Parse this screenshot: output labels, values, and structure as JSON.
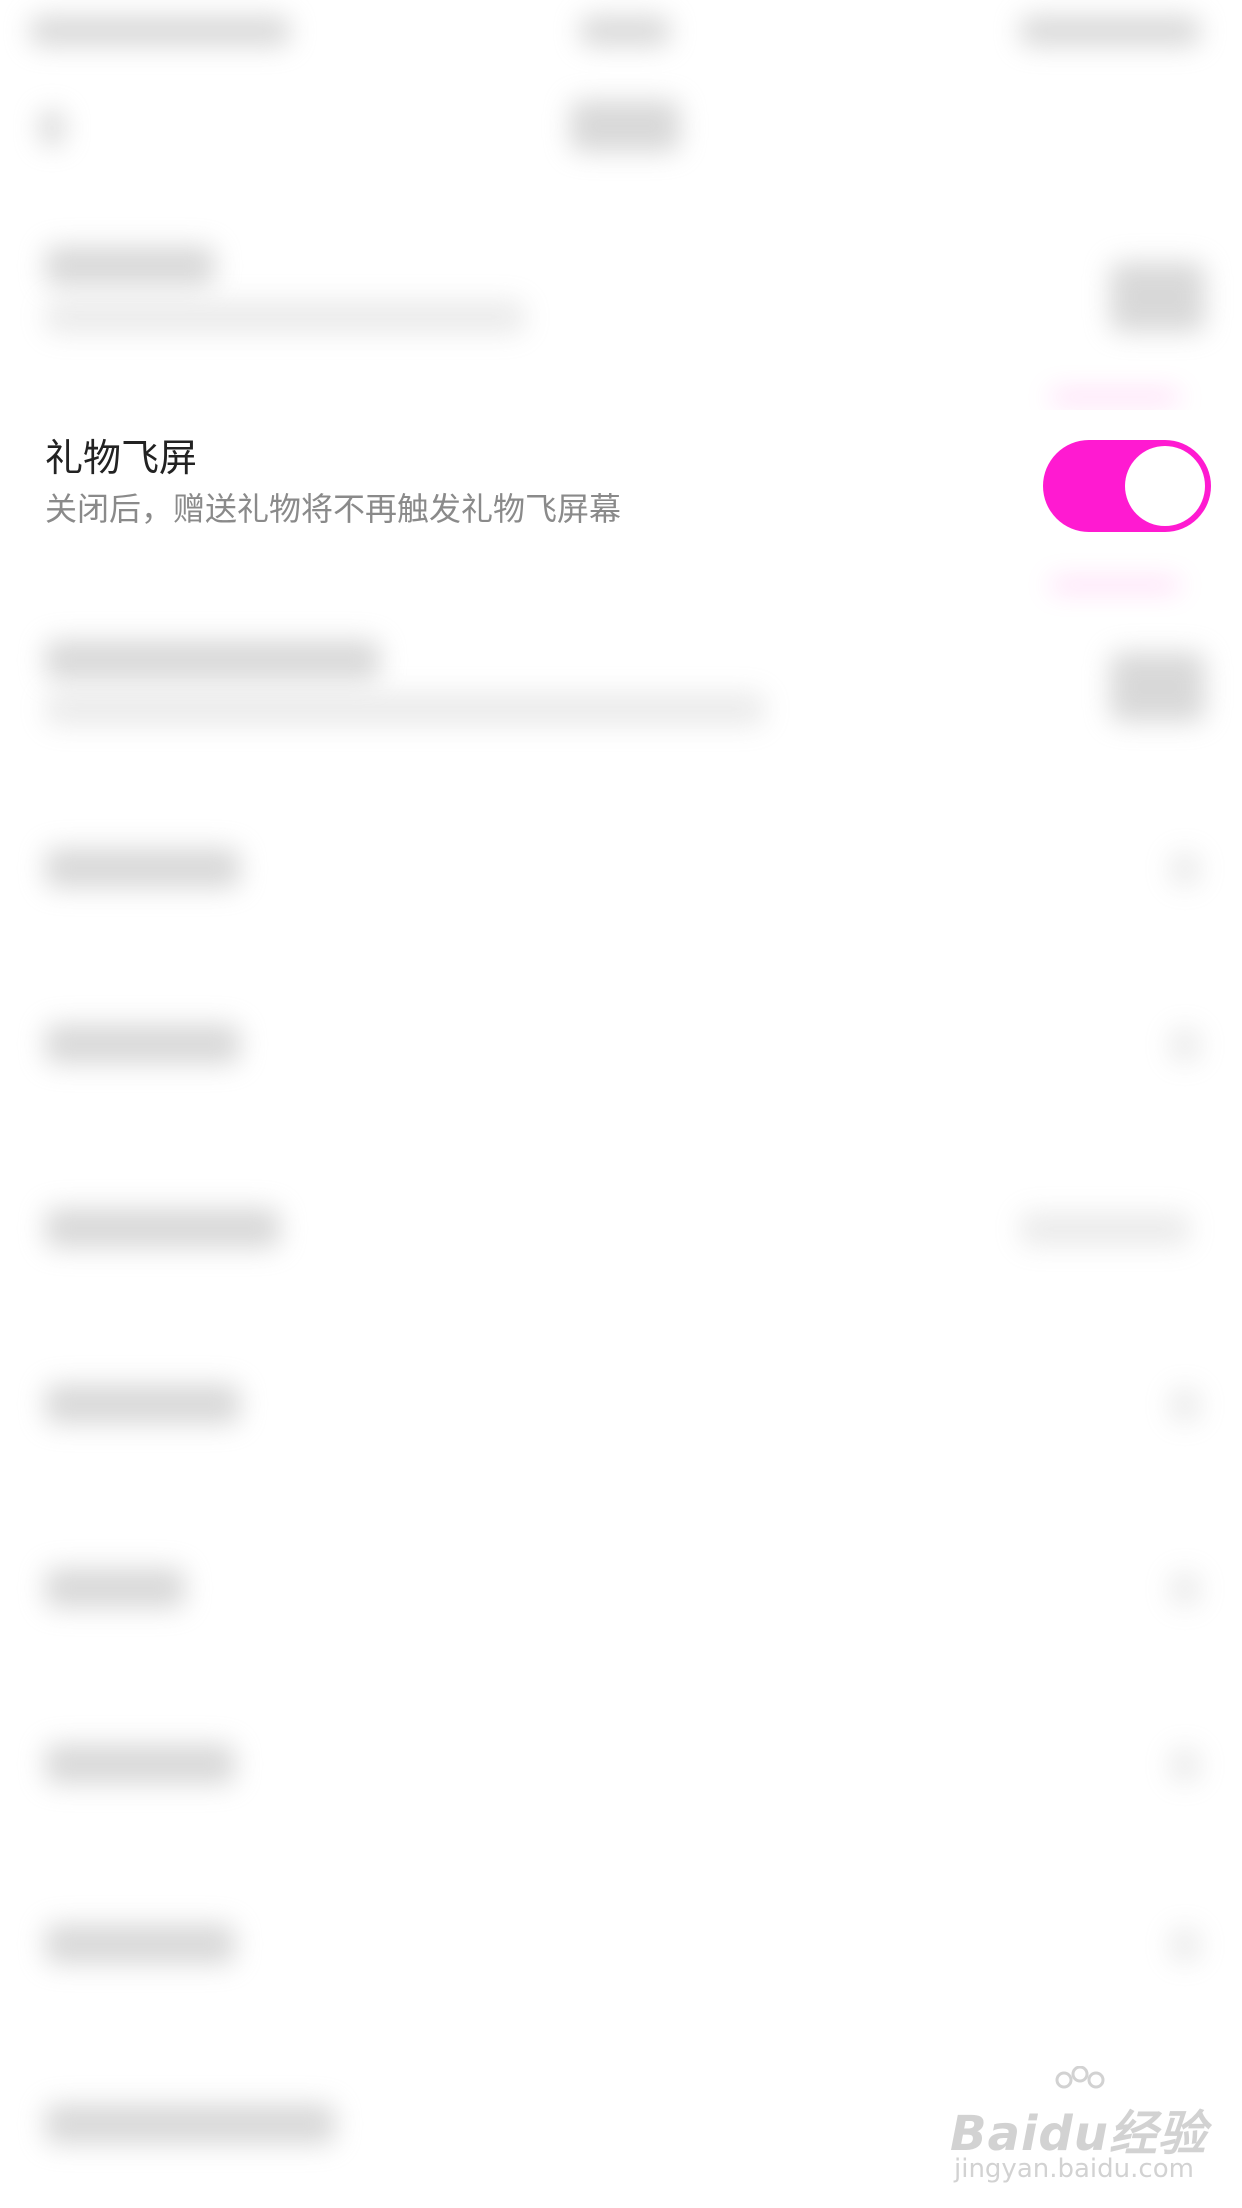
{
  "focused_setting": {
    "title": "礼物飞屏",
    "subtitle": "关闭后，赠送礼物将不再触发礼物飞屏幕",
    "toggle_on": true,
    "accent_color": "#ff1ad1"
  },
  "watermark": {
    "brand": "Baidu经验",
    "url": "jingyan.baidu.com"
  }
}
